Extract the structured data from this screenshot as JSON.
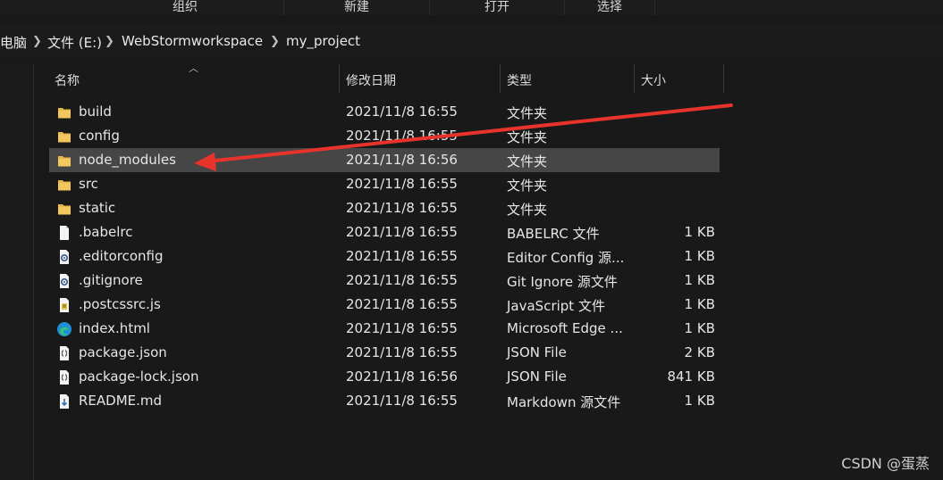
{
  "ribbon": {
    "organize": "组织",
    "new": "新建",
    "open": "打开",
    "select": "选择"
  },
  "address": {
    "crumbs": [
      "电脑",
      "文件 (E:)",
      "WebStormworkspace",
      "my_project"
    ]
  },
  "columns": {
    "name": "名称",
    "date": "修改日期",
    "type": "类型",
    "size": "大小"
  },
  "files": [
    {
      "name": "build",
      "date": "2021/11/8 16:55",
      "type": "文件夹",
      "size": "",
      "icon": "folder-icon"
    },
    {
      "name": "config",
      "date": "2021/11/8 16:55",
      "type": "文件夹",
      "size": "",
      "icon": "folder-icon"
    },
    {
      "name": "node_modules",
      "date": "2021/11/8 16:56",
      "type": "文件夹",
      "size": "",
      "icon": "folder-icon",
      "selected": true
    },
    {
      "name": "src",
      "date": "2021/11/8 16:55",
      "type": "文件夹",
      "size": "",
      "icon": "folder-icon"
    },
    {
      "name": "static",
      "date": "2021/11/8 16:55",
      "type": "文件夹",
      "size": "",
      "icon": "folder-icon"
    },
    {
      "name": ".babelrc",
      "date": "2021/11/8 16:55",
      "type": "BABELRC 文件",
      "size": "1 KB",
      "icon": "file-icon"
    },
    {
      "name": ".editorconfig",
      "date": "2021/11/8 16:55",
      "type": "Editor Config 源...",
      "size": "1 KB",
      "icon": "gear-file-icon"
    },
    {
      "name": ".gitignore",
      "date": "2021/11/8 16:55",
      "type": "Git Ignore 源文件",
      "size": "1 KB",
      "icon": "gear-file-icon"
    },
    {
      "name": ".postcssrc.js",
      "date": "2021/11/8 16:55",
      "type": "JavaScript 文件",
      "size": "1 KB",
      "icon": "script-file-icon"
    },
    {
      "name": "index.html",
      "date": "2021/11/8 16:55",
      "type": "Microsoft Edge ...",
      "size": "1 KB",
      "icon": "edge-icon"
    },
    {
      "name": "package.json",
      "date": "2021/11/8 16:55",
      "type": "JSON File",
      "size": "2 KB",
      "icon": "json-file-icon"
    },
    {
      "name": "package-lock.json",
      "date": "2021/11/8 16:56",
      "type": "JSON File",
      "size": "841 KB",
      "icon": "json-file-icon"
    },
    {
      "name": "README.md",
      "date": "2021/11/8 16:55",
      "type": "Markdown 源文件",
      "size": "1 KB",
      "icon": "markdown-file-icon"
    }
  ],
  "watermark": "CSDN @蛋蒸",
  "colors": {
    "background": "#191919",
    "selected_row": "#464646",
    "folder": "#e8b94a",
    "arrow": "#e8332c"
  }
}
